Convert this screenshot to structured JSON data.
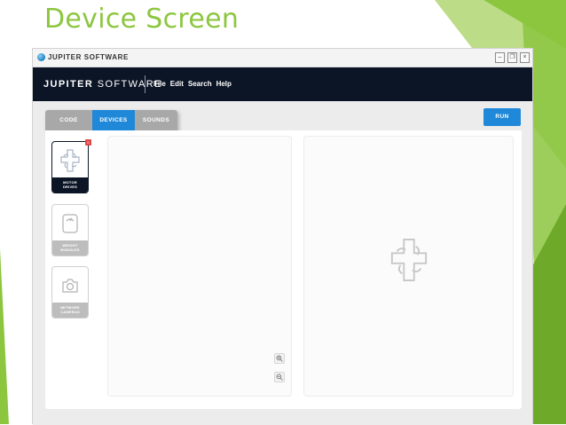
{
  "slide": {
    "title": "Device Screen"
  },
  "window": {
    "title": "JUPITER SOFTWARE",
    "controls": {
      "minimize": "–",
      "restore": "❐",
      "close": "×"
    }
  },
  "appbar": {
    "brand_bold": "JUPITER",
    "brand_light": "SOFTWARE",
    "menu": [
      "File",
      "Edit",
      "Search",
      "Help"
    ]
  },
  "tabs": [
    {
      "label": "CODE",
      "active": false
    },
    {
      "label": "DEVICES",
      "active": true
    },
    {
      "label": "SOUNDS",
      "active": false
    }
  ],
  "run_label": "RUN",
  "devices": [
    {
      "label_line1": "MOTOR",
      "label_line2": "DRIVES",
      "icon": "motor-icon",
      "selected": true,
      "badge": "0"
    },
    {
      "label_line1": "WEIGHT",
      "label_line2": "MODULES",
      "icon": "scale-icon",
      "selected": false
    },
    {
      "label_line1": "NETWORK",
      "label_line2": "CAMERAS",
      "icon": "camera-icon",
      "selected": false
    }
  ],
  "colors": {
    "accent": "#1f88d8",
    "appbar": "#0c1526",
    "slide_green": "#8cc63f",
    "tab_inactive": "#a8a8a8",
    "badge": "#e04848"
  },
  "icons": {
    "zoom_in": "zoom-in-icon",
    "zoom_out": "zoom-out-icon",
    "preview": "motor-icon"
  }
}
